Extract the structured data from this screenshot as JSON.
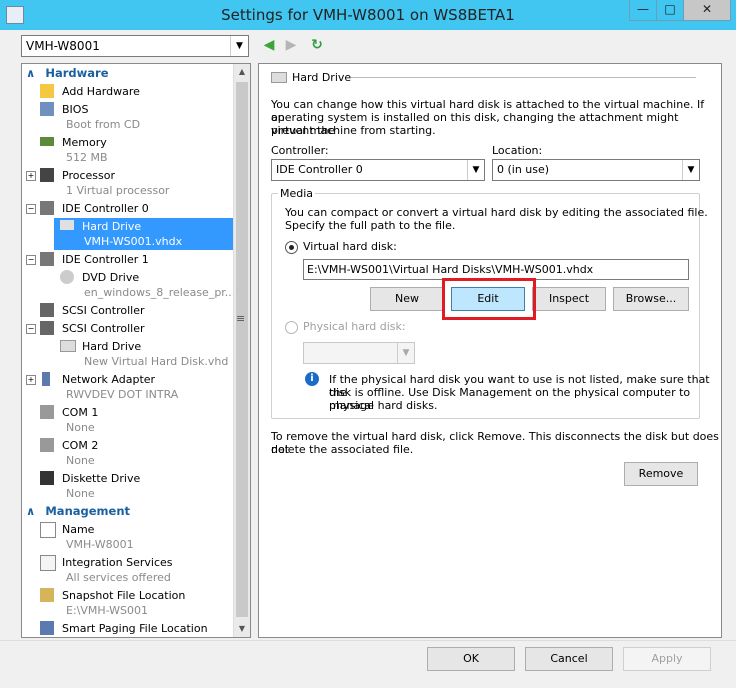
{
  "window": {
    "title": "Settings for VMH-W8001 on WS8BETA1"
  },
  "vm_selector": {
    "value": "VMH-W8001"
  },
  "tree": {
    "hardware_header": "Hardware",
    "management_header": "Management",
    "items": [
      {
        "label": "Add Hardware"
      },
      {
        "label": "BIOS",
        "sub": "Boot from CD"
      },
      {
        "label": "Memory",
        "sub": "512 MB"
      },
      {
        "label": "Processor",
        "sub": "1 Virtual processor"
      },
      {
        "label": "IDE Controller 0"
      },
      {
        "label": "Hard Drive",
        "sub": "VMH-WS001.vhdx"
      },
      {
        "label": "IDE Controller 1"
      },
      {
        "label": "DVD Drive",
        "sub": "en_windows_8_release_pr..."
      },
      {
        "label": "SCSI Controller"
      },
      {
        "label": "SCSI Controller"
      },
      {
        "label": "Hard Drive",
        "sub": "New Virtual Hard Disk.vhd"
      },
      {
        "label": "Network Adapter",
        "sub": "RWVDEV DOT INTRA"
      },
      {
        "label": "COM 1",
        "sub": "None"
      },
      {
        "label": "COM 2",
        "sub": "None"
      },
      {
        "label": "Diskette Drive",
        "sub": "None"
      }
    ],
    "management_items": [
      {
        "label": "Name",
        "sub": "VMH-W8001"
      },
      {
        "label": "Integration Services",
        "sub": "All services offered"
      },
      {
        "label": "Snapshot File Location",
        "sub": "E:\\VMH-WS001"
      },
      {
        "label": "Smart Paging File Location"
      }
    ]
  },
  "panel": {
    "section_title": "Hard Drive",
    "intro_lines": [
      "You can change how this virtual hard disk is attached to the virtual machine. If an",
      "operating system is installed on this disk, changing the attachment might prevent the",
      "virtual machine from starting."
    ],
    "controller_label": "Controller:",
    "controller_value": "IDE Controller 0",
    "location_label": "Location:",
    "location_value": "0 (in use)",
    "media_label": "Media",
    "media_lines": [
      "You can compact or convert a virtual hard disk by editing the associated file.",
      "Specify the full path to the file."
    ],
    "vhd_label": "Virtual hard disk:",
    "vhd_path": "E:\\VMH-WS001\\Virtual Hard Disks\\VMH-WS001.vhdx",
    "buttons": {
      "new": "New",
      "edit": "Edit",
      "inspect": "Inspect",
      "browse": "Browse..."
    },
    "physical_label": "Physical hard disk:",
    "info_lines": [
      "If the physical hard disk you want to use is not listed, make sure that the",
      "disk is offline. Use Disk Management on the physical computer to manage",
      "physical hard disks."
    ],
    "remove_lines": [
      "To remove the virtual hard disk, click Remove. This disconnects the disk but does not",
      "delete the associated file."
    ],
    "remove_button": "Remove"
  },
  "footer": {
    "ok": "OK",
    "cancel": "Cancel",
    "apply": "Apply"
  },
  "colors": {
    "titlebar": "#41c6f1",
    "selection": "#3399ff",
    "highlight_frame": "#e01b24",
    "header_text": "#1a5fa0"
  }
}
